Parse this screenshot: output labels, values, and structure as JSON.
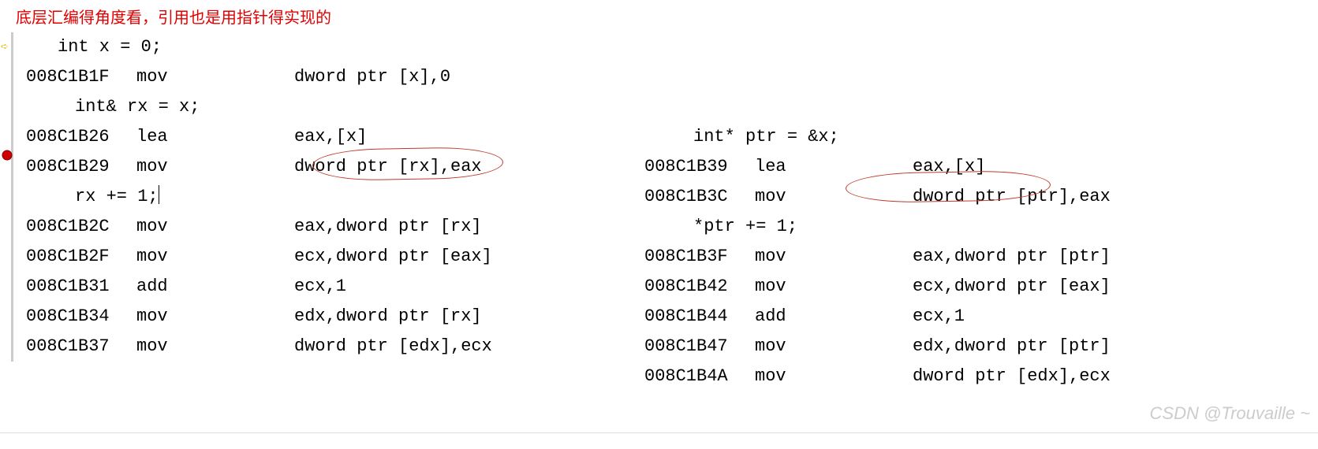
{
  "annotation": "底层汇编得角度看，引用也是用指针得实现的",
  "left": {
    "src1": "int x = 0;",
    "l1_addr": "008C1B1F",
    "l1_op": "mov",
    "l1_args": "dword ptr [x],0",
    "src2": "int& rx = x;",
    "l2_addr": "008C1B26",
    "l2_op": "lea",
    "l2_args": "eax,[x]",
    "l3_addr": "008C1B29",
    "l3_op": "mov",
    "l3_args": "dword ptr [rx],eax",
    "src3": "rx += 1;",
    "l4_addr": "008C1B2C",
    "l4_op": "mov",
    "l4_args": "eax,dword ptr [rx]",
    "l5_addr": "008C1B2F",
    "l5_op": "mov",
    "l5_args": "ecx,dword ptr [eax]",
    "l6_addr": "008C1B31",
    "l6_op": "add",
    "l6_args": "ecx,1",
    "l7_addr": "008C1B34",
    "l7_op": "mov",
    "l7_args": "edx,dword ptr [rx]",
    "l8_addr": "008C1B37",
    "l8_op": "mov",
    "l8_args": "dword ptr [edx],ecx"
  },
  "right": {
    "src1": "int* ptr = &x;",
    "r1_addr": "008C1B39",
    "r1_op": "lea",
    "r1_args": "eax,[x]",
    "r2_addr": "008C1B3C",
    "r2_op": "mov",
    "r2_args": "dword ptr [ptr],eax",
    "src2": "*ptr += 1;",
    "r3_addr": "008C1B3F",
    "r3_op": "mov",
    "r3_args": "eax,dword ptr [ptr]",
    "r4_addr": "008C1B42",
    "r4_op": "mov",
    "r4_args": "ecx,dword ptr [eax]",
    "r5_addr": "008C1B44",
    "r5_op": "add",
    "r5_args": "ecx,1",
    "r6_addr": "008C1B47",
    "r6_op": "mov",
    "r6_args": "edx,dword ptr [ptr]",
    "r7_addr": "008C1B4A",
    "r7_op": "mov",
    "r7_args": "dword ptr [edx],ecx"
  },
  "watermark": "CSDN @Trouvaille ~"
}
